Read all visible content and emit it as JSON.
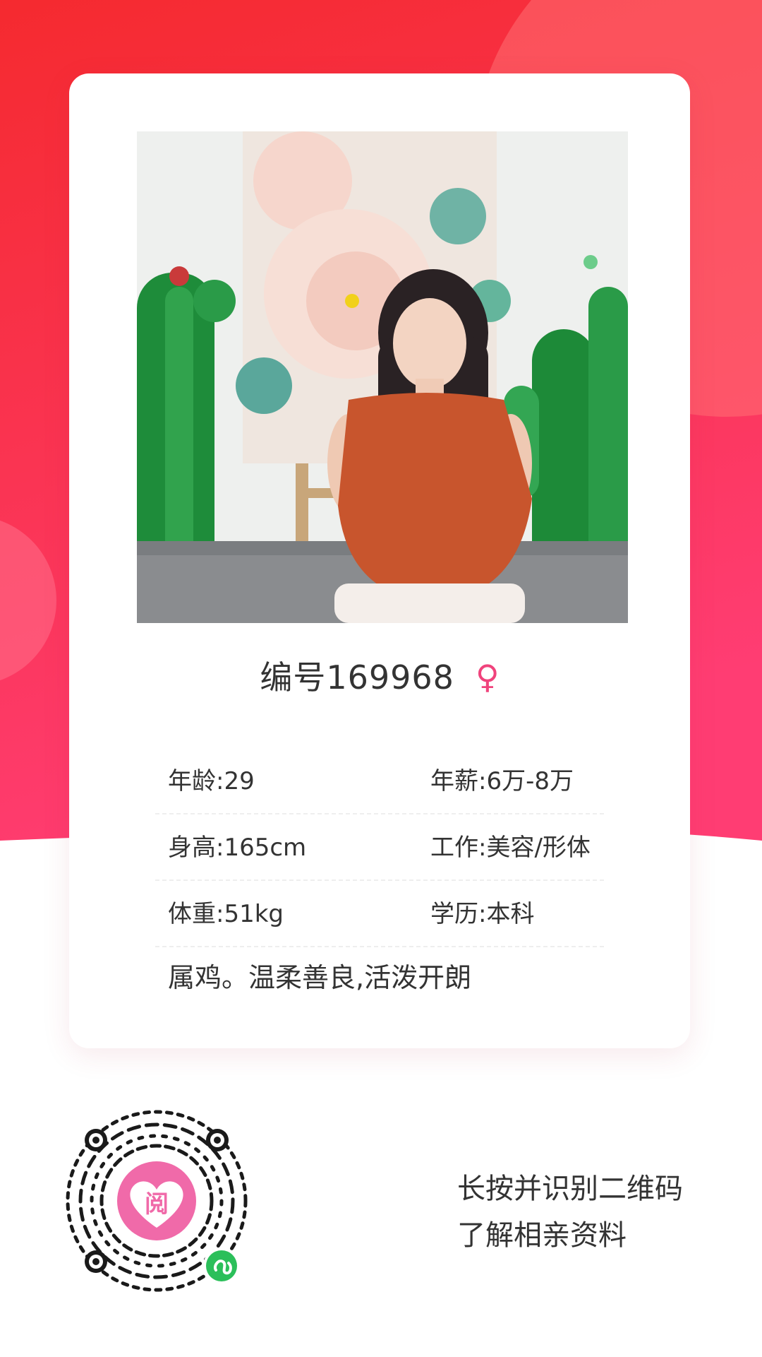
{
  "colors": {
    "background_red": "#f5273f",
    "background_pink": "#ff3d73",
    "accent_pink": "#f0437c",
    "text": "#333333",
    "card": "#ffffff"
  },
  "profile": {
    "title": "编号169968",
    "gender_icon": "female-icon",
    "gender_symbol": "♀",
    "photo_alt": "profile-photo",
    "details": [
      {
        "left": "年龄:29",
        "right": "年薪:6万-8万"
      },
      {
        "left": "身高:165cm",
        "right": "工作:美容/形体"
      },
      {
        "left": "体重:51kg",
        "right": "学历:本科"
      }
    ],
    "intro": "属鸡。温柔善良,活泼开朗"
  },
  "footer": {
    "qr_icon": "mini-program-qr-icon",
    "qr_center_char": "阅",
    "cta_line1": "长按并识别二维码",
    "cta_line2": "了解相亲资料"
  }
}
